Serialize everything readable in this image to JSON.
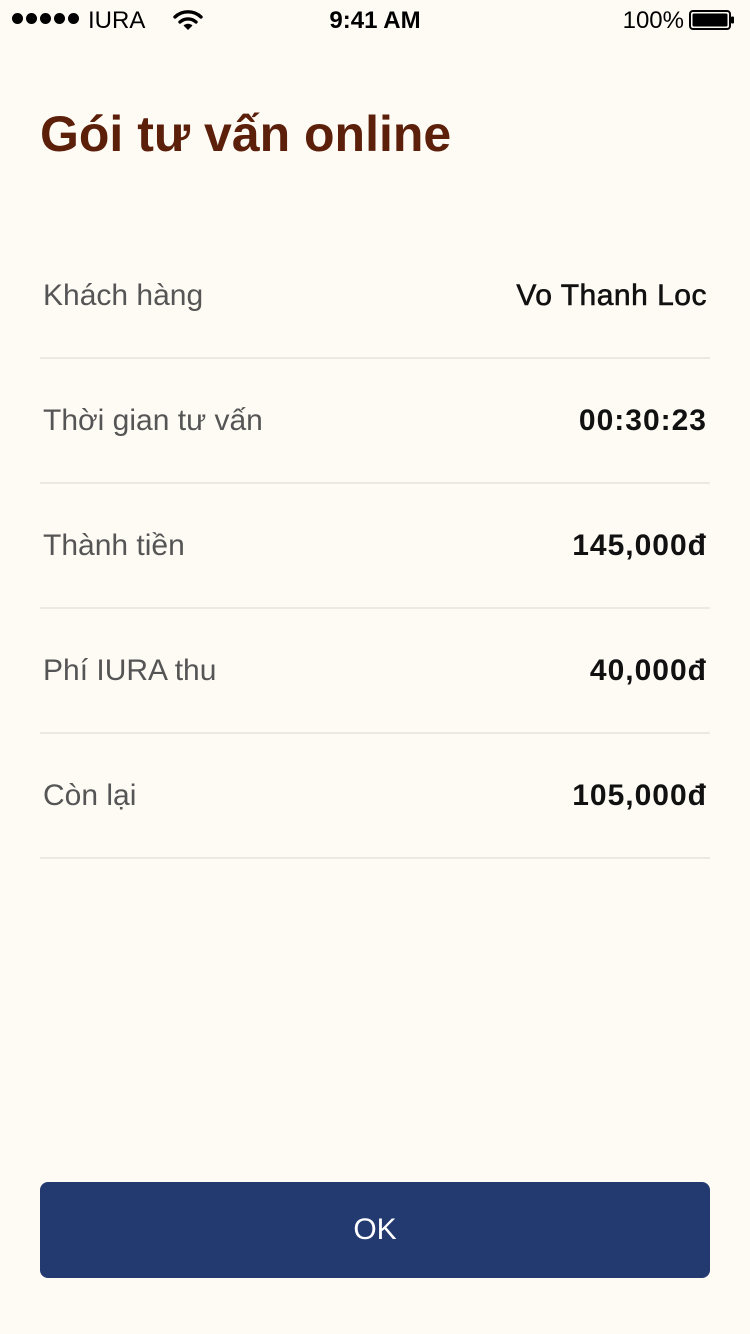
{
  "status_bar": {
    "carrier": "IURA",
    "time": "9:41 AM",
    "battery_percent": "100%",
    "signal_icon": "signal-dots-icon",
    "wifi_icon": "wifi-icon",
    "battery_icon": "battery-icon"
  },
  "page": {
    "title": "Gói tư vấn online"
  },
  "details": [
    {
      "label": "Khách hàng",
      "value": "Vo Thanh Loc"
    },
    {
      "label": "Thời gian tư vấn",
      "value": "00:30:23"
    },
    {
      "label": "Thành tiền",
      "value": "145,000đ"
    },
    {
      "label": "Phí IURA thu",
      "value": "40,000đ"
    },
    {
      "label": "Còn lại",
      "value": "105,000đ"
    }
  ],
  "actions": {
    "ok_label": "OK"
  },
  "colors": {
    "background": "#FEFBF5",
    "title": "#5B1F0A",
    "button": "#233A71",
    "divider": "#ECE9E3"
  }
}
